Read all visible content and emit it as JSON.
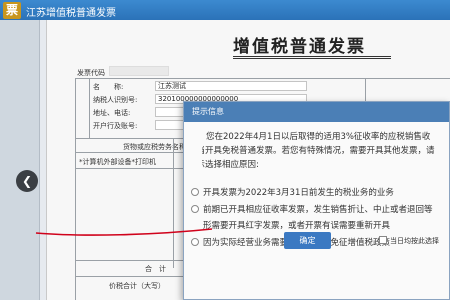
{
  "window": {
    "logo_text": "票",
    "title": "江苏增值税普通发票"
  },
  "invoice": {
    "title": "增值税普通发票",
    "code_label": "发票代码",
    "buyer": {
      "name_label": "名　　称:",
      "name_value": "江苏测试",
      "tax_label": "纳税人识别号:",
      "tax_value": "320100000000000000",
      "addr_label": "地址、电话:",
      "bank_label": "开户行及账号:"
    },
    "goods_header": "货物或应税劳务名称",
    "goods_item": "*计算机外部设备*打印机",
    "total_label": "合　计",
    "grand_total_label": "价税合计（大写）"
  },
  "dialog": {
    "title": "提示信息",
    "message_lines": [
      "您在2022年4月1日以后取得的适用3%征收率的应税销售收",
      "应当开具免税普通发票。若您有特殊情况，需要开具其他发票，请",
      "提示选择相应原因:"
    ],
    "options": [
      {
        "label": "开具发票为2022年3月31日前发生的税业务的业务",
        "selected": false
      },
      {
        "label": "前期已开具相应征收率发票，发生销售折让、中止或者退回等",
        "selected": false,
        "continuation": "形需要开具红字发票，或者开票有误需要重新开具"
      },
      {
        "label": "因为实际经营业务需要，放弃享受免征增值税政策",
        "selected": false
      }
    ],
    "ok_label": "确定",
    "checkbox_label": "当日均按此选择",
    "underline_color": "#d0021b"
  }
}
